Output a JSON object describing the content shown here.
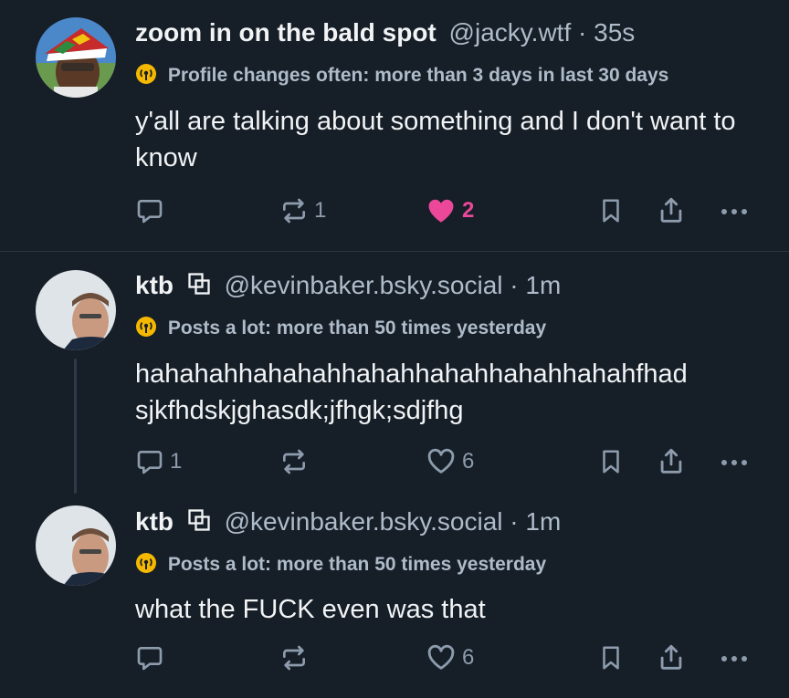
{
  "posts": [
    {
      "display_name": "zoom in on the bald spot",
      "handle": "@jacky.wtf",
      "separator": "·",
      "time": "35s",
      "label": "Profile changes often: more than 3 days in last 30 days",
      "text": "y'all are talking about something and I don't want to know",
      "reply_count": "",
      "repost_count": "1",
      "like_count": "2",
      "liked": true
    },
    {
      "display_name": "ktb",
      "handle": "@kevinbaker.bsky.social",
      "separator": "·",
      "time": "1m",
      "label": "Posts a lot: more than 50 times yesterday",
      "text": "hahahahhahahahhahahhahahhahahhahahfhad sjkfhdskjghasdk;jfhgk;sdjfhg",
      "reply_count": "1",
      "repost_count": "",
      "like_count": "6",
      "liked": false
    },
    {
      "display_name": "ktb",
      "handle": "@kevinbaker.bsky.social",
      "separator": "·",
      "time": "1m",
      "label": "Posts a lot: more than 50 times yesterday",
      "text": "what the FUCK even was that",
      "reply_count": "",
      "repost_count": "",
      "like_count": "6",
      "liked": false
    }
  ],
  "colors": {
    "background": "#161e27",
    "like_active": "#ec4899",
    "label_icon": "#f5b800",
    "muted": "#aebbc9"
  },
  "icons": {
    "reply": "speech-bubble-icon",
    "repost": "repost-arrows-icon",
    "like": "heart-icon",
    "bookmark": "bookmark-icon",
    "share": "share-upload-icon",
    "more": "more-dots-icon",
    "label": "broadcast-label-icon",
    "pal": "linked-squares-icon"
  }
}
